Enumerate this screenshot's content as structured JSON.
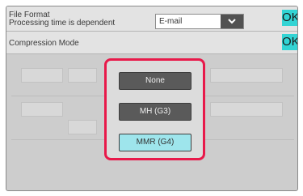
{
  "header": {
    "file_format_label": "File Format",
    "processing_note": "Processing time is dependent",
    "select_value": "E-mail",
    "ok_label": "OK"
  },
  "compression": {
    "title": "Compression Mode",
    "ok_label": "OK",
    "options": [
      {
        "label": "None",
        "selected": false
      },
      {
        "label": "MH (G3)",
        "selected": false
      },
      {
        "label": "MMR (G4)",
        "selected": true
      }
    ]
  },
  "colors": {
    "highlight": "#e8194a",
    "ok_accent": "#33d4d4",
    "selected_option": "#9ee5ec",
    "option_dark": "#5a5a5a"
  },
  "icons": {
    "select_arrow": "chevron-down-icon"
  }
}
